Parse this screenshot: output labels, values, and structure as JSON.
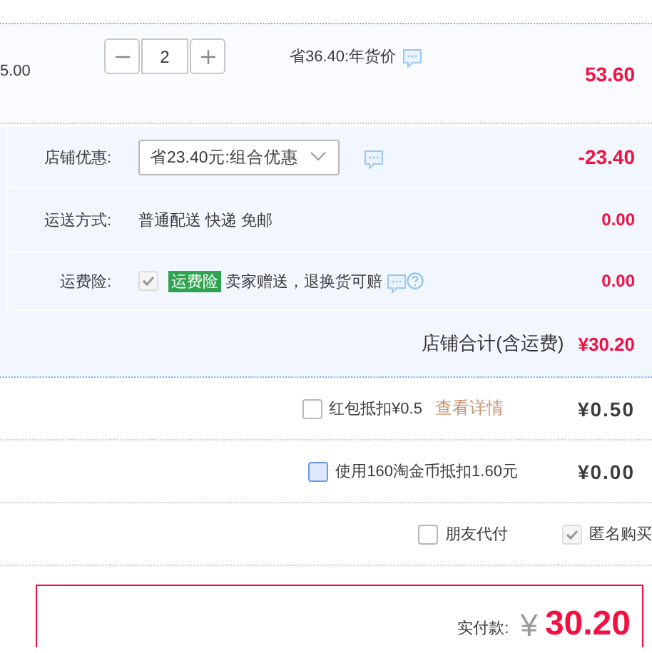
{
  "item": {
    "price": "5.00",
    "quantity": "2",
    "promo": "省36.40:年货价",
    "subtotal": "53.60"
  },
  "shop_rows": [
    {
      "kind": "select",
      "label": "店铺优惠:",
      "value": "省23.40元:组合优惠",
      "amount": "-23.40"
    },
    {
      "kind": "text",
      "label": "运送方式:",
      "value": "普通配送 快递 免邮",
      "amount": "0.00"
    },
    {
      "kind": "insurance",
      "label": "运费险:",
      "checked": true,
      "disabled": true,
      "tag": "运费险",
      "value": "卖家赠送，退换货可赔",
      "amount": "0.00"
    }
  ],
  "shop_total": {
    "label": "店铺合计(含运费)",
    "amount": "¥30.20"
  },
  "discounts": [
    {
      "label": "红包抵扣¥0.5",
      "link": "查看详情",
      "checked": false,
      "highlighted": false,
      "amount": "¥0.50"
    },
    {
      "label": "使用160淘金币抵扣1.60元",
      "checked": false,
      "highlighted": true,
      "amount": "¥0.00"
    }
  ],
  "options": [
    {
      "label": "朋友代付",
      "checked": false,
      "disabled": false
    },
    {
      "label": "匿名购买",
      "checked": true,
      "disabled": true
    }
  ],
  "payment": {
    "label": "实付款:",
    "currency": "¥",
    "amount": "30.20"
  }
}
